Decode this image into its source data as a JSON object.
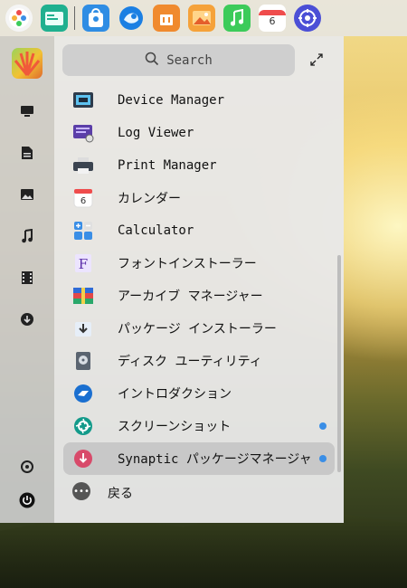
{
  "dock": {
    "items": [
      {
        "name": "launcher-icon",
        "color": "#f0f0f0"
      },
      {
        "name": "file-manager-icon",
        "color": "#25b596"
      },
      {
        "name": "app-store-icon",
        "color": "#2f8de4"
      },
      {
        "name": "browser-icon",
        "color": "#1e7fe0"
      },
      {
        "name": "shop-icon",
        "color": "#f08a2e"
      },
      {
        "name": "photos-icon",
        "color": "#f5a23a"
      },
      {
        "name": "music-icon",
        "color": "#3ccb5a"
      },
      {
        "name": "calendar-icon",
        "color": "#ffffff"
      },
      {
        "name": "settings-icon",
        "color": "#4b4fd6"
      }
    ],
    "calendar_day": "6"
  },
  "search": {
    "label": "Search"
  },
  "apps": [
    {
      "label": "Device Manager",
      "icon": "device-manager-icon",
      "dot": false
    },
    {
      "label": "Log Viewer",
      "icon": "log-viewer-icon",
      "dot": false
    },
    {
      "label": "Print Manager",
      "icon": "printer-icon",
      "dot": false
    },
    {
      "label": "カレンダー",
      "icon": "calendar-icon",
      "dot": false
    },
    {
      "label": "Calculator",
      "icon": "calculator-icon",
      "dot": false
    },
    {
      "label": "フォントインストーラー",
      "icon": "font-installer-icon",
      "dot": false
    },
    {
      "label": "アーカイブ マネージャー",
      "icon": "archive-manager-icon",
      "dot": false
    },
    {
      "label": "パッケージ インストーラー",
      "icon": "package-installer-icon",
      "dot": false
    },
    {
      "label": "ディスク ユーティリティ",
      "icon": "disk-utility-icon",
      "dot": false
    },
    {
      "label": "イントロダクション",
      "icon": "introduction-icon",
      "dot": false
    },
    {
      "label": "スクリーンショット",
      "icon": "screenshot-icon",
      "dot": true
    },
    {
      "label": "Synaptic パッケージマネージャ",
      "icon": "synaptic-icon",
      "dot": true
    }
  ],
  "back": {
    "label": "戻る"
  },
  "font_icon_letter": "F",
  "accent": "#3a8ee6"
}
